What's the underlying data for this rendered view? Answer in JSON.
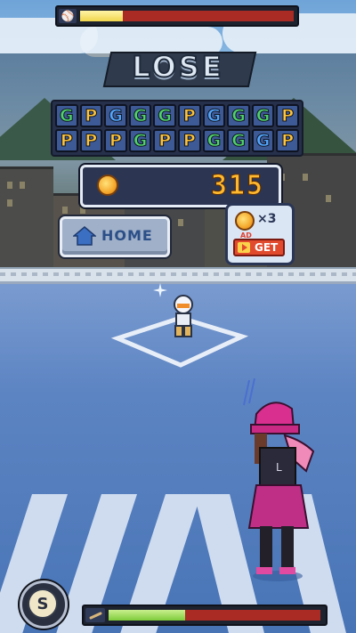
{
  "hud": {
    "top_bar": {
      "icon": "ball-icon",
      "fill": 0.2,
      "fill_color": "#f0d54a",
      "empty_color": "#aa2a24"
    },
    "bottom_bar": {
      "icon": "bat-icon",
      "fill": 0.36,
      "fill_color": "#7ecb3a",
      "empty_color": "#aa2a24"
    },
    "skill_button": {
      "label": "S"
    }
  },
  "result": {
    "title": "LOSE",
    "letters_row1": [
      "G",
      "P",
      "G",
      "G",
      "G",
      "P",
      "G",
      "G",
      "G",
      "P"
    ],
    "letters_row2": [
      "P",
      "P",
      "P",
      "G",
      "P",
      "P",
      "G",
      "G",
      "G",
      "P"
    ],
    "row1_styles": [
      "G",
      "P",
      "B",
      "G",
      "G",
      "P",
      "B",
      "G",
      "G",
      "P"
    ],
    "row2_styles": [
      "P",
      "P",
      "P",
      "G",
      "P",
      "P",
      "G",
      "G",
      "B",
      "P"
    ],
    "coins": "315",
    "home_label": "HOME",
    "ad_bonus": {
      "multiplier": "×3",
      "ad_tag": "AD",
      "get_label": "GET"
    }
  },
  "colors": {
    "accent_gold": "#ffb92e",
    "panel": "#26304a"
  }
}
